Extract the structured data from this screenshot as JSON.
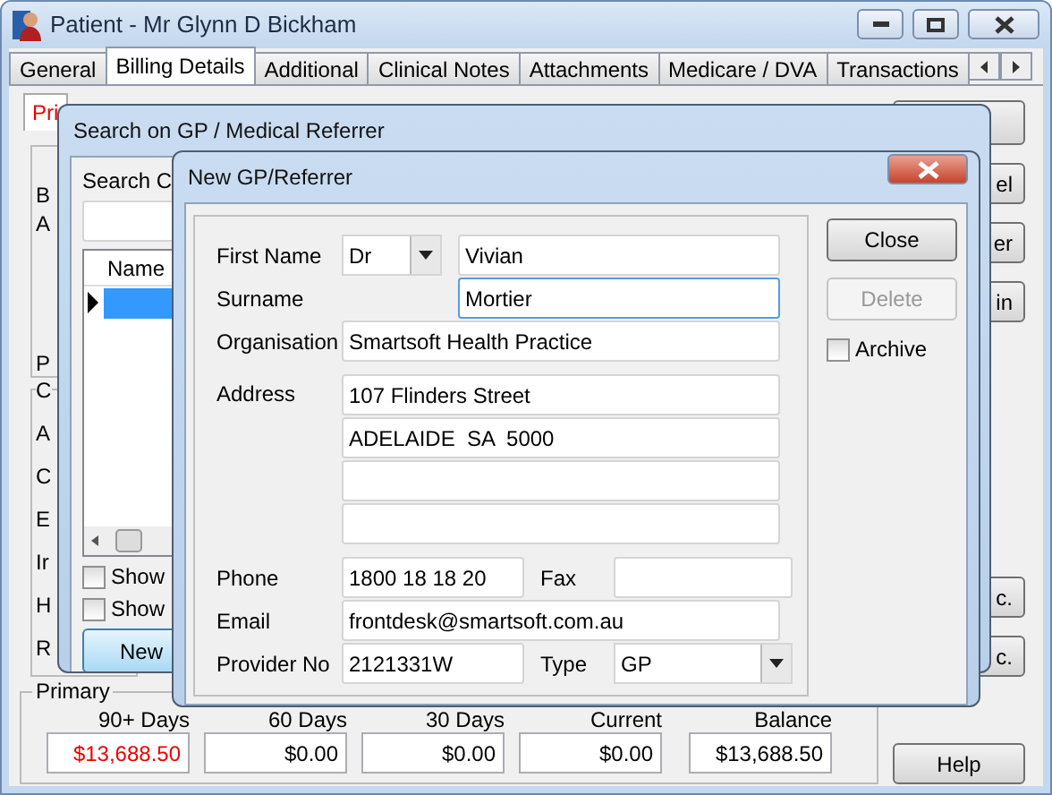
{
  "window": {
    "title": "Patient - Mr Glynn D Bickham"
  },
  "tabs": [
    {
      "label": "General",
      "selected": false
    },
    {
      "label": "Billing Details",
      "selected": true
    },
    {
      "label": "Additional",
      "selected": false
    },
    {
      "label": "Clinical Notes",
      "selected": false
    },
    {
      "label": "Attachments",
      "selected": false
    },
    {
      "label": "Medicare / DVA",
      "selected": false
    },
    {
      "label": "Transactions",
      "selected": false
    }
  ],
  "billing_panel": {
    "subtab": "Pri",
    "group_1": [
      "B",
      "A",
      "P"
    ],
    "group_2": {
      "legend": "C",
      "labels": [
        "A",
        "C",
        "E",
        "Ir",
        "H",
        "R"
      ]
    },
    "right_buttons_top": [
      "el",
      "er",
      "in"
    ],
    "right_buttons_bottom": [
      "c.",
      "c."
    ],
    "help_button": "Help"
  },
  "primary": {
    "legend": "Primary",
    "columns": [
      {
        "label": "90+ Days",
        "value": "$13,688.50",
        "overdue": true
      },
      {
        "label": "60 Days",
        "value": "$0.00",
        "overdue": false
      },
      {
        "label": "30 Days",
        "value": "$0.00",
        "overdue": false
      },
      {
        "label": "Current",
        "value": "$0.00",
        "overdue": false
      },
      {
        "label": "Balance",
        "value": "$13,688.50",
        "overdue": false
      }
    ]
  },
  "search_dialog": {
    "title": "Search on GP / Medical Referrer",
    "search_label": "Search C",
    "grid_header": "Name",
    "checkboxes": [
      {
        "label": "Show",
        "checked": false
      },
      {
        "label": "Show",
        "checked": false
      }
    ],
    "new_button": "New"
  },
  "new_dialog": {
    "title": "New GP/Referrer",
    "first_name": {
      "label": "First Name",
      "title": "Dr",
      "value": "Vivian"
    },
    "surname": {
      "label": "Surname",
      "value": "Mortier"
    },
    "organisation": {
      "label": "Organisation",
      "value": "Smartsoft Health Practice"
    },
    "address": {
      "label": "Address",
      "lines": [
        "107 Flinders Street",
        "ADELAIDE  SA  5000"
      ]
    },
    "phone": {
      "label": "Phone",
      "value": "1800 18 18 20"
    },
    "fax": {
      "label": "Fax"
    },
    "email": {
      "label": "Email",
      "value": "frontdesk@smartsoft.com.au"
    },
    "provider_no": {
      "label": "Provider No",
      "value": "2121331W"
    },
    "type": {
      "label": "Type",
      "value": "GP"
    },
    "buttons": [
      {
        "label": "Close",
        "disabled": false
      },
      {
        "label": "Delete",
        "disabled": true
      }
    ],
    "archive": {
      "label": "Archive",
      "checked": false
    }
  }
}
